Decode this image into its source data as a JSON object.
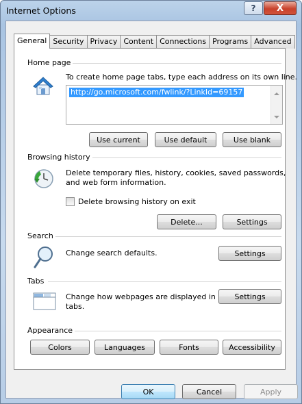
{
  "window": {
    "title": "Internet Options",
    "help_glyph": "?",
    "close_glyph": "X"
  },
  "tabs": [
    {
      "label": "General",
      "active": true
    },
    {
      "label": "Security"
    },
    {
      "label": "Privacy"
    },
    {
      "label": "Content"
    },
    {
      "label": "Connections"
    },
    {
      "label": "Programs"
    },
    {
      "label": "Advanced"
    }
  ],
  "home_page": {
    "group_label": "Home page",
    "description": "To create home page tabs, type each address on its own line.",
    "url_value": "http://go.microsoft.com/fwlink/?LinkId=69157",
    "use_current": "Use current",
    "use_default": "Use default",
    "use_blank": "Use blank"
  },
  "browsing_history": {
    "group_label": "Browsing history",
    "description_line1": "Delete temporary files, history, cookies, saved passwords,",
    "description_line2": "and web form information.",
    "checkbox_label": "Delete browsing history on exit",
    "checkbox_checked": false,
    "delete_button": "Delete...",
    "settings_button": "Settings"
  },
  "search": {
    "group_label": "Search",
    "description": "Change search defaults.",
    "settings_button": "Settings"
  },
  "tabs_section": {
    "group_label": "Tabs",
    "description_line1": "Change how webpages are displayed in",
    "description_line2": "tabs.",
    "settings_button": "Settings"
  },
  "appearance": {
    "group_label": "Appearance",
    "colors": "Colors",
    "languages": "Languages",
    "fonts": "Fonts",
    "accessibility": "Accessibility"
  },
  "footer": {
    "ok": "OK",
    "cancel": "Cancel",
    "apply": "Apply",
    "apply_enabled": false
  },
  "colors": {
    "selection": "#3399ff",
    "default_button_border": "#3c7fb1",
    "close_button": "#c8412b"
  }
}
